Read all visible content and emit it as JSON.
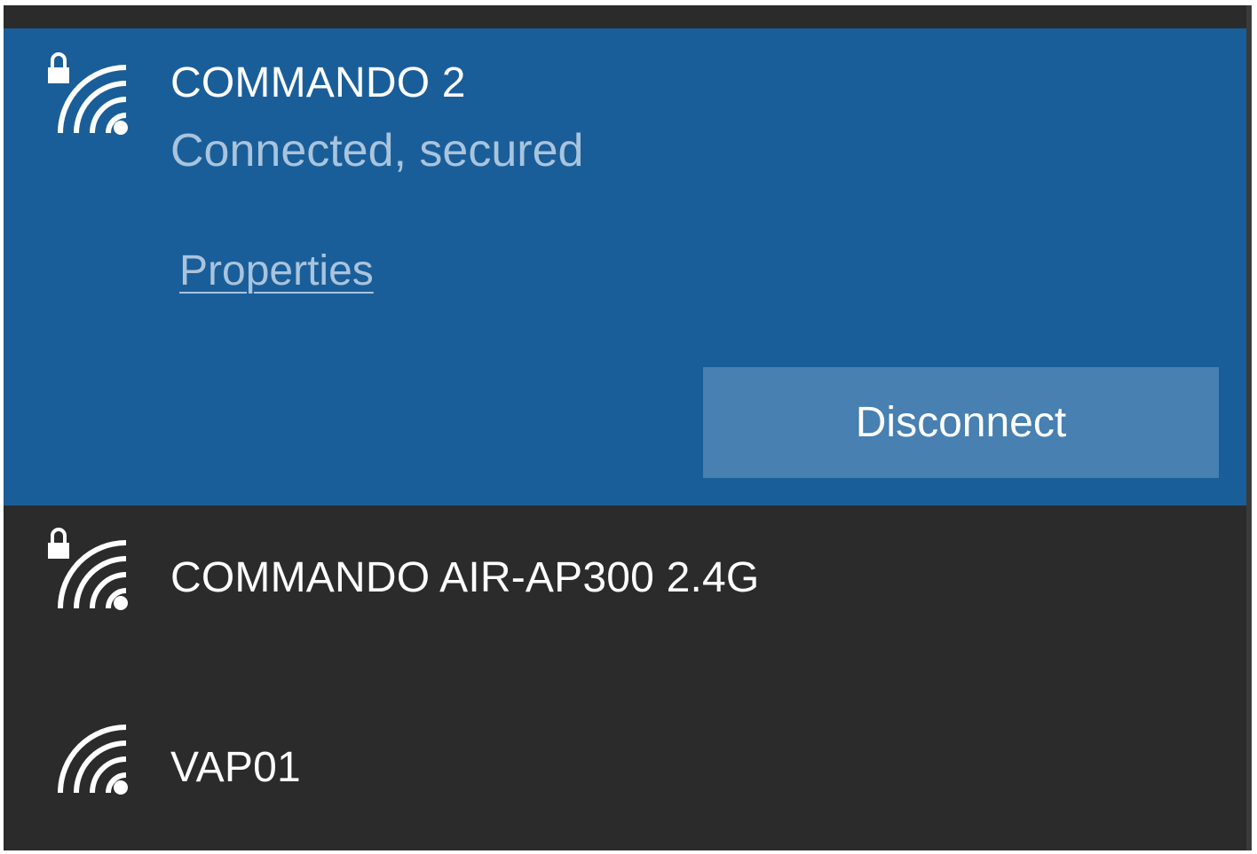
{
  "networks": [
    {
      "name": "COMMANDO 2",
      "status": "Connected, secured",
      "secured": true,
      "selected": true,
      "properties_label": "Properties",
      "disconnect_label": "Disconnect",
      "icon": "wifi-secured-icon"
    },
    {
      "name": "COMMANDO AIR-AP300 2.4G",
      "secured": true,
      "selected": false,
      "icon": "wifi-secured-icon"
    },
    {
      "name": "VAP01",
      "secured": false,
      "selected": false,
      "icon": "wifi-icon"
    }
  ],
  "colors": {
    "selected_background": "#1a5e99",
    "panel_background": "#2b2b2b",
    "button_background": "#4780b1",
    "secondary_text": "#a9c4dd"
  }
}
